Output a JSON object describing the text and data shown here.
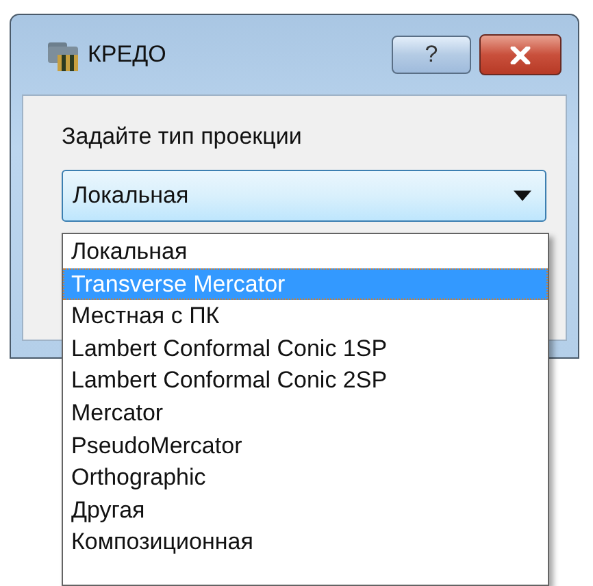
{
  "window": {
    "title": "КРЕДО",
    "help_button": "?"
  },
  "prompt": "Задайте тип проекции",
  "combo": {
    "value": "Локальная"
  },
  "options": [
    {
      "label": "Локальная",
      "selected": false
    },
    {
      "label": "Transverse Mercator",
      "selected": true
    },
    {
      "label": "Местная с ПК",
      "selected": false
    },
    {
      "label": "Lambert Conformal Conic 1SP",
      "selected": false
    },
    {
      "label": "Lambert Conformal Conic 2SP",
      "selected": false
    },
    {
      "label": "Mercator",
      "selected": false
    },
    {
      "label": "PseudoMercator",
      "selected": false
    },
    {
      "label": "Orthographic",
      "selected": false
    },
    {
      "label": "Другая",
      "selected": false
    },
    {
      "label": "Композиционная",
      "selected": false
    }
  ]
}
